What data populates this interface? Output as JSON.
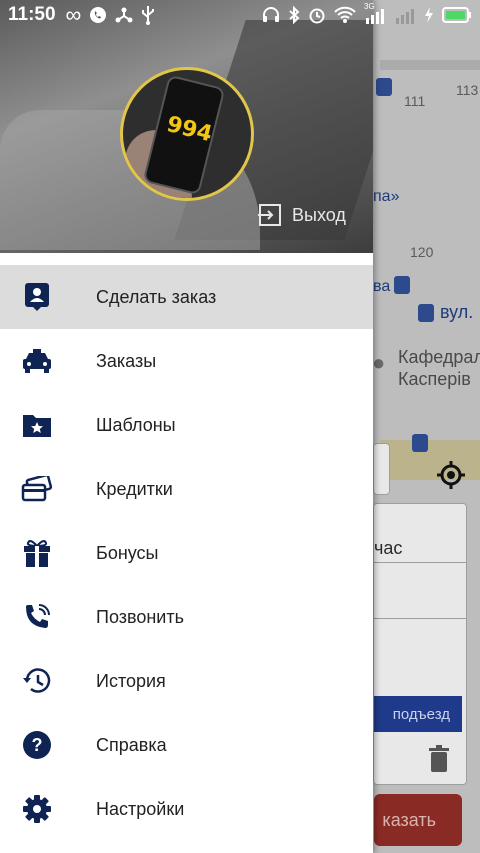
{
  "statusbar": {
    "time": "11:50",
    "infinity": "∞",
    "cell_label": "3G",
    "battery_color": "#4cd964"
  },
  "map": {
    "num_111": "111",
    "num_113": "113",
    "num_120": "120",
    "street_pa": "па»",
    "street_va": "ва",
    "street_vul": "вул.",
    "place_kafedr": "Кафедрал",
    "place_kasper": "Касперів",
    "time_field": "час",
    "entrance_button": "подъезд",
    "order_button": "казать"
  },
  "drawer": {
    "avatar_number": "994",
    "logout_label": "Выход",
    "accent_color": "#0f2453",
    "items": [
      {
        "label": "Сделать заказ",
        "icon": "contact-card-icon",
        "active": true
      },
      {
        "label": "Заказы",
        "icon": "taxi-car-icon"
      },
      {
        "label": "Шаблоны",
        "icon": "star-folder-icon"
      },
      {
        "label": "Кредитки",
        "icon": "credit-cards-icon"
      },
      {
        "label": "Бонусы",
        "icon": "gift-icon"
      },
      {
        "label": "Позвонить",
        "icon": "phone-call-icon"
      },
      {
        "label": "История",
        "icon": "history-icon"
      },
      {
        "label": "Справка",
        "icon": "help-icon"
      },
      {
        "label": "Настройки",
        "icon": "settings-gear-icon"
      }
    ]
  }
}
